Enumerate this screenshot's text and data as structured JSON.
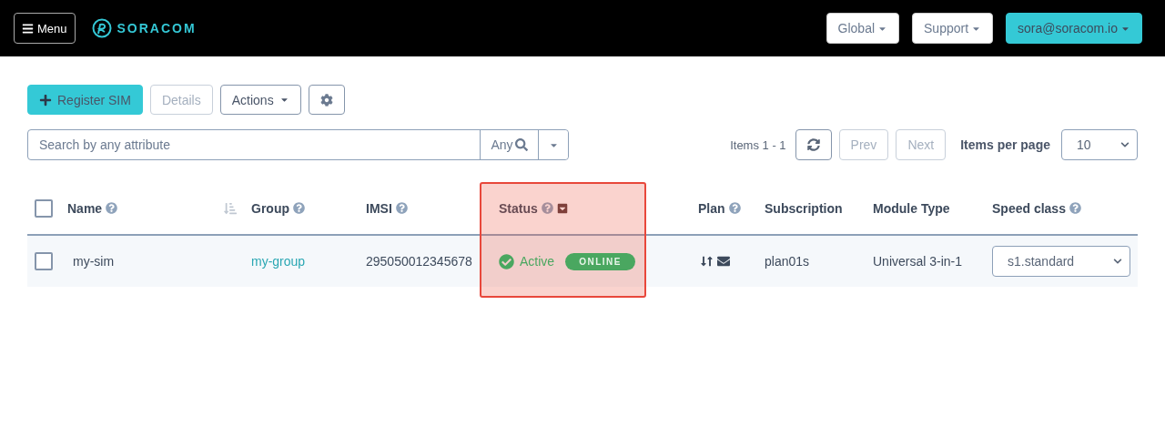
{
  "navbar": {
    "menu_button": "Menu",
    "logo_text": "SORACOM",
    "buttons": [
      {
        "label": "Global",
        "kind": "light"
      },
      {
        "label": "Support",
        "kind": "light"
      },
      {
        "label": "sora@soracom.io",
        "kind": "primary"
      }
    ]
  },
  "toolbar": {
    "register_button": "Register SIM",
    "details_button": {
      "label": "Details",
      "disabled": true
    },
    "actions_button": "Actions"
  },
  "search": {
    "placeholder": "Search by any attribute",
    "scope": "Any"
  },
  "pagination": {
    "items": "Items 1 - 1",
    "prev": {
      "label": "Prev",
      "disabled": true
    },
    "next": {
      "label": "Next",
      "disabled": true
    },
    "per_page_label": "Items per page",
    "per_page": "10"
  },
  "table": {
    "select_all_checked": false,
    "columns": [
      {
        "kind": "text",
        "label": "Name",
        "help": true,
        "highlighted": false
      },
      {
        "kind": "sort"
      },
      {
        "kind": "text",
        "label": "Group",
        "help": true,
        "highlighted": false
      },
      {
        "kind": "text",
        "label": "IMSI",
        "help": true,
        "highlighted": false
      },
      {
        "kind": "text",
        "label": "Status",
        "help": true,
        "filter": true,
        "highlighted": true
      },
      {
        "kind": "text",
        "label": "Plan",
        "help": true,
        "highlighted": false
      },
      {
        "kind": "text",
        "label": "Subscription",
        "help": false,
        "highlighted": false
      },
      {
        "kind": "text",
        "label": "Module Type",
        "help": false,
        "highlighted": false
      },
      {
        "kind": "text",
        "label": "Speed class",
        "help": true,
        "highlighted": false
      }
    ],
    "rows": [
      {
        "checked": false,
        "name": "my-sim",
        "group": "my-group",
        "imsi": "295050012345678",
        "status": "Active",
        "online": "ONLINE",
        "subscription": "plan01s",
        "module_type": "Universal 3-in-1",
        "speed_class": "s1.standard"
      }
    ]
  }
}
